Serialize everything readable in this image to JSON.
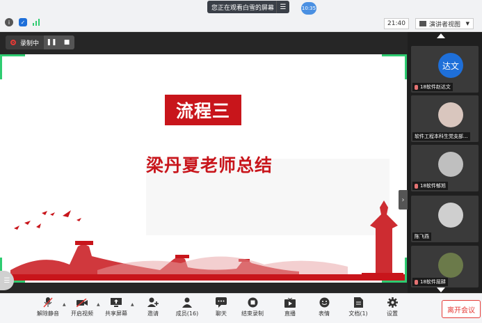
{
  "topbar": {
    "banner_text": "您正在观看白雪的屏幕",
    "menu_icon": "hamburger-icon",
    "timer": "10:35",
    "clock": "21:40",
    "view_label": "演讲者视图"
  },
  "recording": {
    "label": "录制中",
    "pause": "❚❚",
    "stop": "■"
  },
  "slide": {
    "title": "流程三",
    "subtitle": "梁丹夏老师总结"
  },
  "participants": [
    {
      "name": "18软件赵达文",
      "avatar_text": "达文",
      "avatar_color": "#1e6fd9"
    },
    {
      "name": "软件工程本科生党支部...",
      "avatar_text": "",
      "avatar_color": "#d9c6be"
    },
    {
      "name": "18软件郁旭",
      "avatar_text": "",
      "avatar_color": "#bfbfbf"
    },
    {
      "name": "陈飞燕",
      "avatar_text": "",
      "avatar_color": "#cfcfcf"
    },
    {
      "name": "18软件屈耕",
      "avatar_text": "",
      "avatar_color": "#6b7a4a"
    }
  ],
  "toolbar": {
    "items": [
      {
        "label": "解除静音",
        "icon": "mic-muted-icon"
      },
      {
        "label": "开启视频",
        "icon": "camera-off-icon"
      },
      {
        "label": "共享屏幕",
        "icon": "share-screen-icon"
      },
      {
        "label": "邀请",
        "icon": "invite-icon"
      },
      {
        "label": "成员(16)",
        "icon": "members-icon"
      },
      {
        "label": "聊天",
        "icon": "chat-icon"
      },
      {
        "label": "结束录制",
        "icon": "stop-record-icon"
      },
      {
        "label": "直播",
        "icon": "live-icon"
      },
      {
        "label": "表情",
        "icon": "emoji-icon"
      },
      {
        "label": "文档(1)",
        "icon": "document-icon"
      },
      {
        "label": "设置",
        "icon": "settings-icon"
      }
    ],
    "leave": "离开会议"
  },
  "colors": {
    "accent_red": "#c8151b",
    "frame_green": "#2ecc71"
  }
}
